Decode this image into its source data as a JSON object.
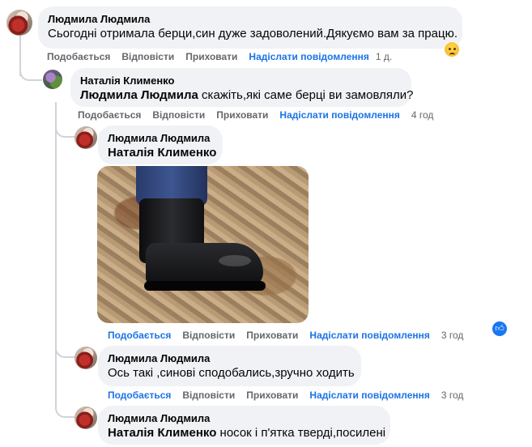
{
  "labels": {
    "like": "Подобається",
    "reply": "Відповісти",
    "hide": "Приховати",
    "resend": "Надіслати повідомлення"
  },
  "comments": [
    {
      "author": "Людмила Людмила",
      "text": "Сьогодні отримала берци,син дуже задоволений.Дякуємо вам за працю.",
      "time": "1 д.",
      "reaction": "sad-emoji"
    },
    {
      "author": "Наталія Клименко",
      "mention": "Людмила Людмила",
      "text": "скажіть,які саме берці ви замовляли?",
      "time": "4 год"
    },
    {
      "author": "Людмила Людмила",
      "mention": "Наталія Клименко",
      "text": "",
      "time": "3 год",
      "reaction": "like-reaction",
      "photo": "boot-photo"
    },
    {
      "author": "Людмила Людмила",
      "text": "Ось такі ,синові сподобались,зручно ходить",
      "time": "3 год"
    },
    {
      "author": "Людмила Людмила",
      "mention": "Наталія Клименко",
      "text": "носок і п'ятка тверді,посилені"
    }
  ]
}
